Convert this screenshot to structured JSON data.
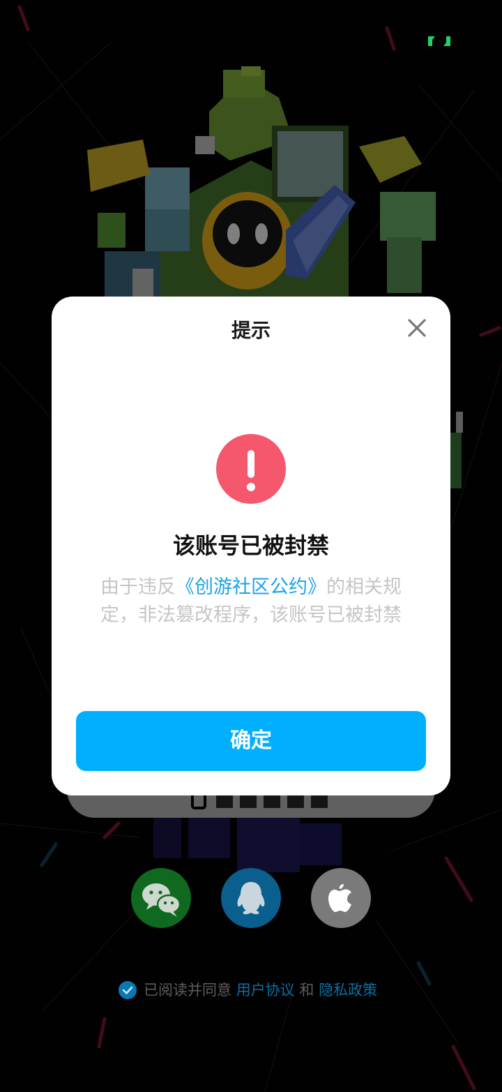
{
  "dialog": {
    "title": "提示",
    "headline": "该账号已被封禁",
    "message_before": "由于违反",
    "message_link": "《创游社区公约》",
    "message_after": "的相关规定，非法篡改程序，该账号已被封禁",
    "confirm_label": "确定"
  },
  "social_login": [
    {
      "icon": "wechat-icon",
      "color": "#0f6a1f"
    },
    {
      "icon": "qq-icon",
      "color": "#0a5f8f"
    },
    {
      "icon": "apple-icon",
      "color": "#7a7a7a"
    }
  ],
  "agreement": {
    "prefix": "已阅读并同意",
    "user_agreement": "用户协议",
    "and": "和",
    "privacy_policy": "隐私政策"
  },
  "colors": {
    "accent": "#00b0ff",
    "alert": "#f5576c",
    "link": "#1aa3ea"
  }
}
